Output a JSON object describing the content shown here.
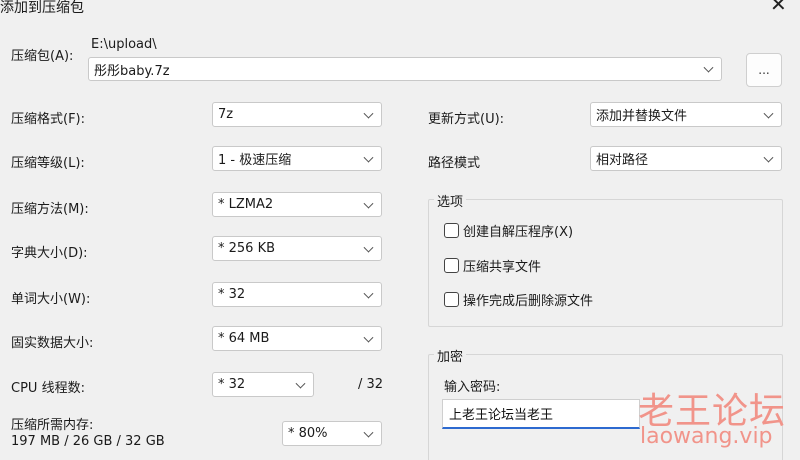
{
  "window": {
    "title": "添加到压缩包",
    "close_glyph": "✕"
  },
  "archive": {
    "label": "压缩包(A):",
    "path": "E:\\upload\\",
    "name": "彤彤baby.7z",
    "browse_label": "..."
  },
  "left": {
    "format": {
      "label": "压缩格式(F):",
      "value": "7z"
    },
    "level": {
      "label": "压缩等级(L):",
      "value": "1 - 极速压缩"
    },
    "method": {
      "label": "压缩方法(M):",
      "value": "*  LZMA2"
    },
    "dict": {
      "label": "字典大小(D):",
      "value": "*  256 KB"
    },
    "word": {
      "label": "单词大小(W):",
      "value": "*  32"
    },
    "solid": {
      "label": "固实数据大小:",
      "value": "*  64 MB"
    },
    "threads": {
      "label": "CPU 线程数:",
      "value": "*  32",
      "max": "/ 32"
    },
    "memory": {
      "label": "压缩所需内存:",
      "info": "197 MB / 26 GB / 32 GB",
      "value": "*  80%"
    }
  },
  "right": {
    "update": {
      "label": "更新方式(U):",
      "value": "添加并替换文件"
    },
    "pathmode": {
      "label": "路径模式",
      "value": "相对路径"
    },
    "options": {
      "title": "选项",
      "items": [
        {
          "label": "创建自解压程序(X)"
        },
        {
          "label": "压缩共享文件"
        },
        {
          "label": "操作完成后删除源文件"
        }
      ]
    },
    "encrypt": {
      "title": "加密",
      "pw_label": "输入密码:",
      "pw_value": "上老王论坛当老王"
    }
  },
  "watermark": {
    "cn": "老王论坛",
    "en": "laowang.vip"
  }
}
